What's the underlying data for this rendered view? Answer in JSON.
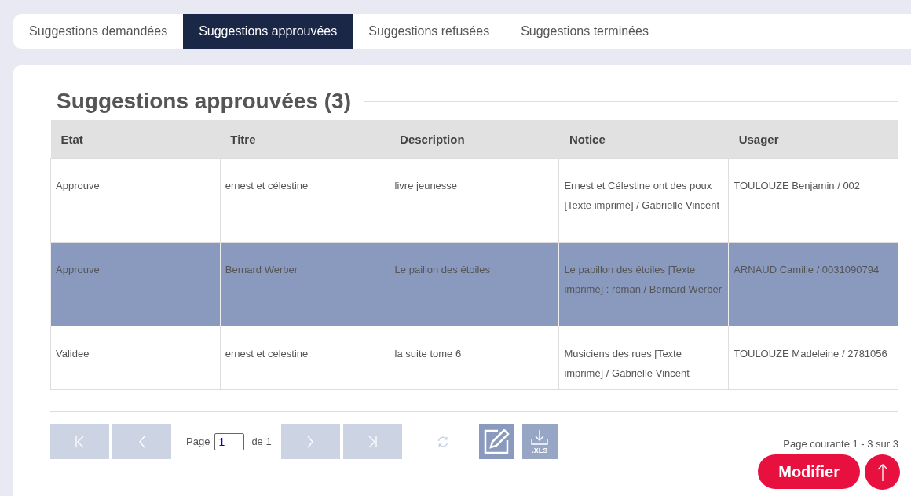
{
  "tabs": [
    {
      "label": "Suggestions demandées",
      "selected": false
    },
    {
      "label": "Suggestions approuvées",
      "selected": true
    },
    {
      "label": "Suggestions refusées",
      "selected": false
    },
    {
      "label": "Suggestions terminées",
      "selected": false
    }
  ],
  "heading": "Suggestions approuvées (3)",
  "table": {
    "columns": [
      "Etat",
      "Titre",
      "Description",
      "Notice",
      "Usager"
    ],
    "rows": [
      {
        "selected": false,
        "cells": [
          "Approuve",
          "ernest et célestine",
          "livre jeunesse",
          "Ernest et Célestine ont des poux [Texte imprimé] / Gabrielle Vincent",
          "TOULOUZE Benjamin / 002"
        ]
      },
      {
        "selected": true,
        "cells": [
          "Approuve",
          "Bernard Werber",
          "Le paillon des étoiles",
          "Le papillon des étoiles [Texte imprimé] : roman / Bernard Werber",
          "ARNAUD Camille / 0031090794"
        ]
      },
      {
        "selected": false,
        "cells": [
          "Validee",
          "ernest et celestine",
          "la suite tome 6",
          "Musiciens des rues [Texte imprimé] / Gabrielle Vincent",
          "TOULOUZE Madeleine / 2781056"
        ]
      }
    ]
  },
  "pager": {
    "page_label": "Page",
    "page_value": "1",
    "of_label": "de 1",
    "export_label": ".XLS",
    "summary": "Page courante 1 - 3 sur 3"
  },
  "modify_button": "Modifier"
}
